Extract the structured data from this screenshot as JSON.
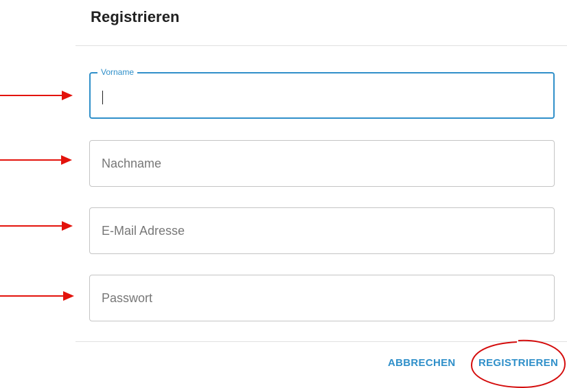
{
  "dialog": {
    "title": "Registrieren"
  },
  "form": {
    "fields": [
      {
        "name": "vorname",
        "label": "Vorname",
        "value": "",
        "placeholder": "",
        "focused": true
      },
      {
        "name": "nachname",
        "label": "",
        "value": "",
        "placeholder": "Nachname",
        "focused": false
      },
      {
        "name": "email",
        "label": "",
        "value": "",
        "placeholder": "E-Mail Adresse",
        "focused": false
      },
      {
        "name": "passwort",
        "label": "",
        "value": "",
        "placeholder": "Passwort",
        "focused": false
      }
    ]
  },
  "actions": {
    "cancel_label": "ABBRECHEN",
    "register_label": "REGISTRIEREN"
  },
  "annotations": {
    "arrow_color": "#e3120b",
    "circle_color": "#d40c0c"
  },
  "colors": {
    "accent": "#2f8fc9",
    "border": "#c4c4c4"
  }
}
